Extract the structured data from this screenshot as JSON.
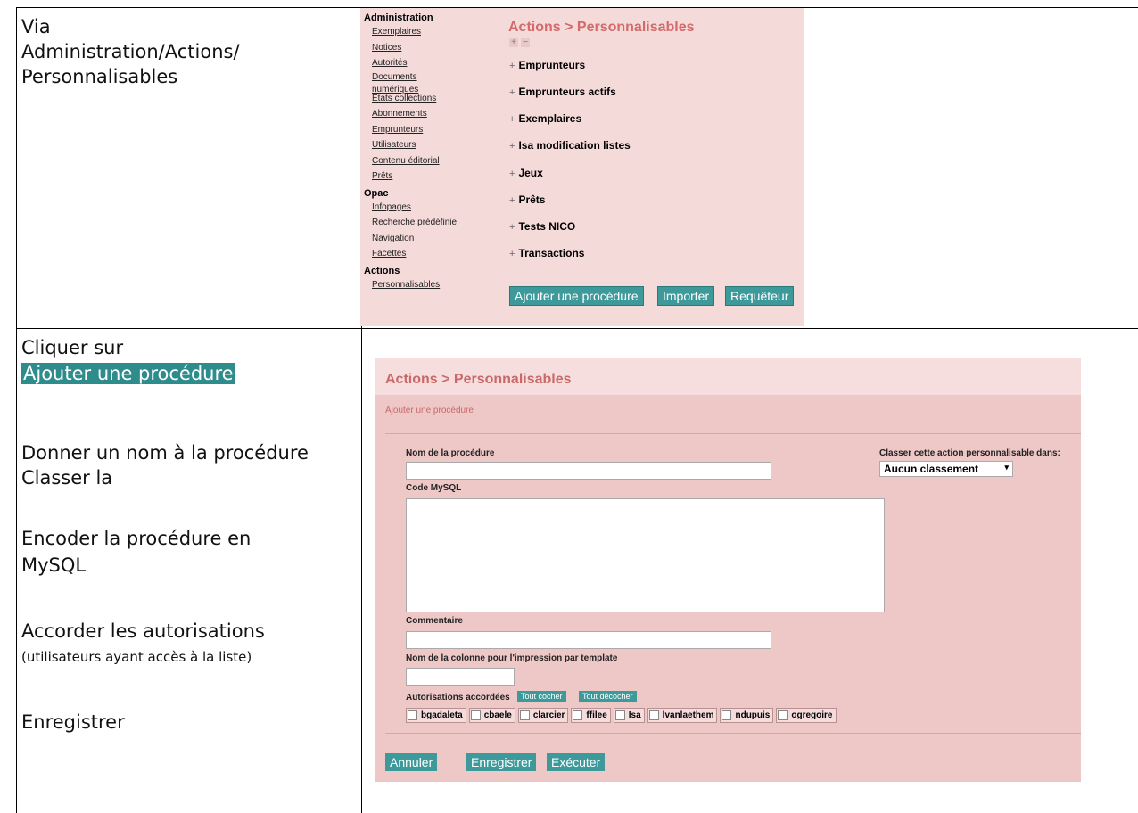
{
  "row1": {
    "left_text": [
      "Via",
      "Administration/Actions/",
      "Personnalisables"
    ],
    "menu": {
      "sections": [
        {
          "title": "Administration",
          "items": [
            "Exemplaires",
            "Notices",
            "Autorités",
            "Documents numériques",
            "Etats collections",
            "Abonnements",
            "Emprunteurs",
            "Utilisateurs",
            "Contenu éditorial",
            "Prêts"
          ]
        },
        {
          "title": "Opac",
          "items": [
            "Infopages",
            "Recherche prédéfinie",
            "Navigation",
            "Facettes"
          ]
        },
        {
          "title": "Actions",
          "items": [
            "Personnalisables"
          ]
        }
      ]
    },
    "title": "Actions > Personnalisables",
    "groups": [
      "Emprunteurs",
      "Emprunteurs actifs",
      "Exemplaires",
      "Isa modification listes",
      "Jeux",
      "Prêts",
      "Tests NICO",
      "Transactions"
    ],
    "buttons": {
      "add": "Ajouter une procédure",
      "import": "Importer",
      "requeteur": "Requêteur"
    }
  },
  "row2": {
    "left": {
      "line1": "Cliquer sur",
      "highlight": "Ajouter une procédure",
      "line3": "Donner un nom à la procédure",
      "line4": "Classer la",
      "line5": "Encoder la procédure en",
      "line6": "MySQL",
      "line7": "Accorder les autorisations",
      "line8": "(utilisateurs ayant accès à la liste)",
      "line9": "Enregistrer"
    },
    "title": "Actions > Personnalisables",
    "subtitle": "Ajouter une procédure",
    "labels": {
      "name": "Nom de la procédure",
      "classify": "Classer cette action personnalisable dans:",
      "code": "Code MySQL",
      "comment": "Commentaire",
      "column": "Nom de la colonne pour l'impression par template",
      "auth": "Autorisations accordées"
    },
    "classify_value": "Aucun classement",
    "check_all": "Tout cocher",
    "uncheck_all": "Tout décocher",
    "users": [
      "bgadaleta",
      "cbaele",
      "clarcier",
      "ffilee",
      "Isa",
      "lvanlaethem",
      "ndupuis",
      "ogregoire"
    ],
    "buttons": {
      "cancel": "Annuler",
      "save": "Enregistrer",
      "exec": "Exécuter"
    }
  }
}
